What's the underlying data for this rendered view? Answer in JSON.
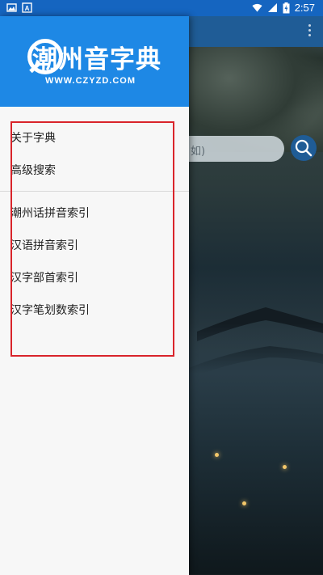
{
  "status_bar": {
    "time": "2:57",
    "left_icons": [
      "image-icon",
      "font-icon"
    ],
    "right_icons": [
      "wifi-icon",
      "signal-icon",
      "battery-charging-icon"
    ]
  },
  "background": {
    "search_placeholder": "如)",
    "toolbar_color": "#1f5c96"
  },
  "drawer": {
    "header": {
      "title": "潮州音字典",
      "url": "WWW.CZYZD.COM",
      "background": "#1e88e5"
    },
    "section1": [
      {
        "label": "关于字典"
      },
      {
        "label": "高级搜索"
      }
    ],
    "section2": [
      {
        "label": "潮州话拼音索引"
      },
      {
        "label": "汉语拼音索引"
      },
      {
        "label": "汉字部首索引"
      },
      {
        "label": "汉字笔划数索引"
      }
    ]
  },
  "highlight_color": "#d9242b"
}
